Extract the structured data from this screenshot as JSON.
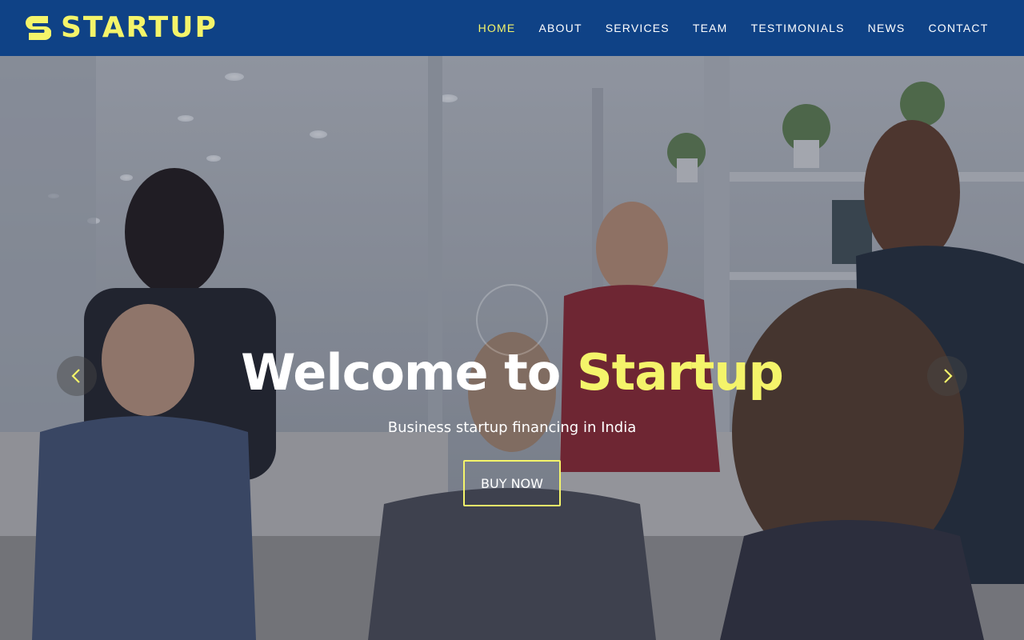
{
  "brand": {
    "logo_text": "STARTUP",
    "logo_icon": "s-logo-icon",
    "accent_color": "#f4f46a",
    "header_color": "#0f4286"
  },
  "nav": {
    "items": [
      {
        "label": "HOME",
        "active": true
      },
      {
        "label": "ABOUT",
        "active": false
      },
      {
        "label": "SERVICES",
        "active": false
      },
      {
        "label": "TEAM",
        "active": false
      },
      {
        "label": "TESTIMONIALS",
        "active": false
      },
      {
        "label": "NEWS",
        "active": false
      },
      {
        "label": "CONTACT",
        "active": false
      }
    ]
  },
  "hero": {
    "title_prefix": "Welcome to ",
    "title_highlight": "Startup",
    "subtitle": "Business startup financing in India",
    "button_label": "BUY NOW",
    "prev_icon": "chevron-left-icon",
    "next_icon": "chevron-right-icon"
  }
}
